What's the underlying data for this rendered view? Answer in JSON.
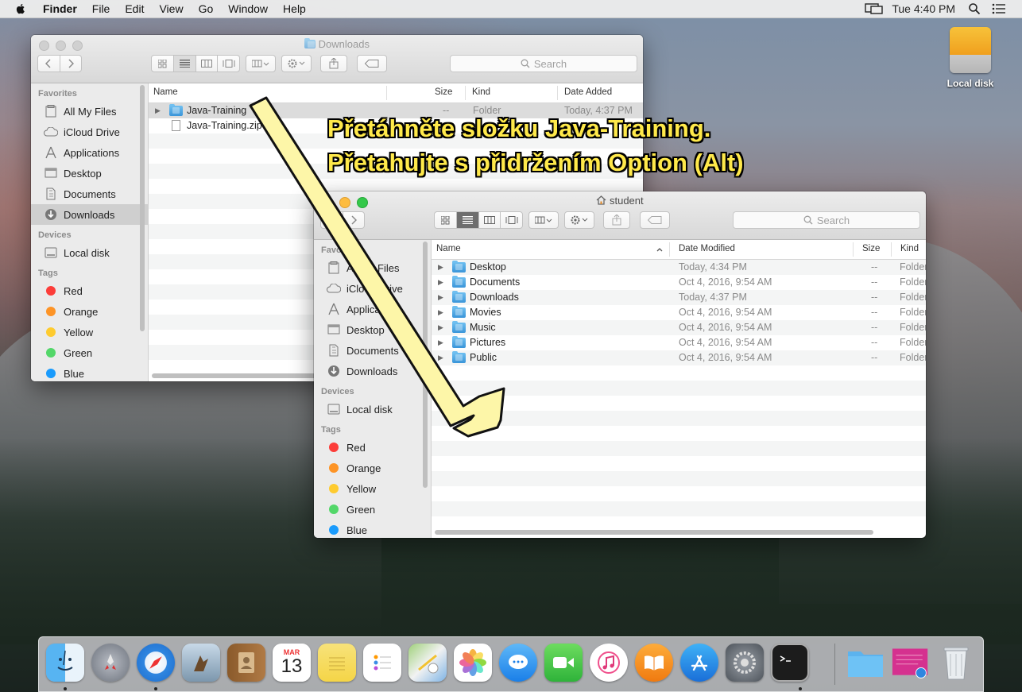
{
  "menubar": {
    "app_name": "Finder",
    "items": [
      "File",
      "Edit",
      "View",
      "Go",
      "Window",
      "Help"
    ],
    "clock": "Tue 4:40 PM"
  },
  "desktop": {
    "disk_label": "Local disk"
  },
  "instruction": {
    "line1": "Přetáhněte složku Java-Training.",
    "line2": "Přetahujte s přidržením Option (Alt)",
    "color": "#ffe94a"
  },
  "win_downloads": {
    "title": "Downloads",
    "search_placeholder": "Search",
    "sidebar": {
      "favorites_head": "Favorites",
      "favorites": [
        "All My Files",
        "iCloud Drive",
        "Applications",
        "Desktop",
        "Documents",
        "Downloads"
      ],
      "devices_head": "Devices",
      "devices": [
        "Local disk"
      ],
      "tags_head": "Tags",
      "tags": [
        {
          "label": "Red",
          "color": "#fc3d39"
        },
        {
          "label": "Orange",
          "color": "#fd9426"
        },
        {
          "label": "Yellow",
          "color": "#fecb2f"
        },
        {
          "label": "Green",
          "color": "#53d769"
        },
        {
          "label": "Blue",
          "color": "#1a9bfc"
        }
      ]
    },
    "columns": {
      "name": "Name",
      "size": "Size",
      "kind": "Kind",
      "date": "Date Added"
    },
    "rows": [
      {
        "name": "Java-Training",
        "size": "--",
        "kind": "Folder",
        "date": "Today, 4:37 PM"
      },
      {
        "name": "Java-Training.zip",
        "size": "",
        "kind": "",
        "date": ""
      }
    ]
  },
  "win_student": {
    "title": "student",
    "search_placeholder": "Search",
    "sidebar": {
      "favorites_head": "Favorites",
      "favorites": [
        "All My Files",
        "iCloud Drive",
        "Applications",
        "Desktop",
        "Documents",
        "Downloads"
      ],
      "devices_head": "Devices",
      "devices": [
        "Local disk"
      ],
      "tags_head": "Tags",
      "tags": [
        {
          "label": "Red",
          "color": "#fc3d39"
        },
        {
          "label": "Orange",
          "color": "#fd9426"
        },
        {
          "label": "Yellow",
          "color": "#fecb2f"
        },
        {
          "label": "Green",
          "color": "#53d769"
        },
        {
          "label": "Blue",
          "color": "#1a9bfc"
        }
      ]
    },
    "columns": {
      "name": "Name",
      "date": "Date Modified",
      "size": "Size",
      "kind": "Kind"
    },
    "rows": [
      {
        "name": "Desktop",
        "date": "Today, 4:34 PM",
        "size": "--",
        "kind": "Folder"
      },
      {
        "name": "Documents",
        "date": "Oct 4, 2016, 9:54 AM",
        "size": "--",
        "kind": "Folder"
      },
      {
        "name": "Downloads",
        "date": "Today, 4:37 PM",
        "size": "--",
        "kind": "Folder"
      },
      {
        "name": "Movies",
        "date": "Oct 4, 2016, 9:54 AM",
        "size": "--",
        "kind": "Folder"
      },
      {
        "name": "Music",
        "date": "Oct 4, 2016, 9:54 AM",
        "size": "--",
        "kind": "Folder"
      },
      {
        "name": "Pictures",
        "date": "Oct 4, 2016, 9:54 AM",
        "size": "--",
        "kind": "Folder"
      },
      {
        "name": "Public",
        "date": "Oct 4, 2016, 9:54 AM",
        "size": "--",
        "kind": "Folder"
      }
    ]
  },
  "dock": {
    "calendar_month": "MAR",
    "calendar_day": "13",
    "apps": [
      "finder",
      "launchpad",
      "safari",
      "mail",
      "contacts",
      "calendar",
      "notes",
      "reminders",
      "maps",
      "photos",
      "messages",
      "facetime",
      "itunes",
      "ibooks",
      "app-store",
      "system-preferences",
      "terminal",
      "downloads-folder",
      "preview",
      "trash"
    ]
  }
}
